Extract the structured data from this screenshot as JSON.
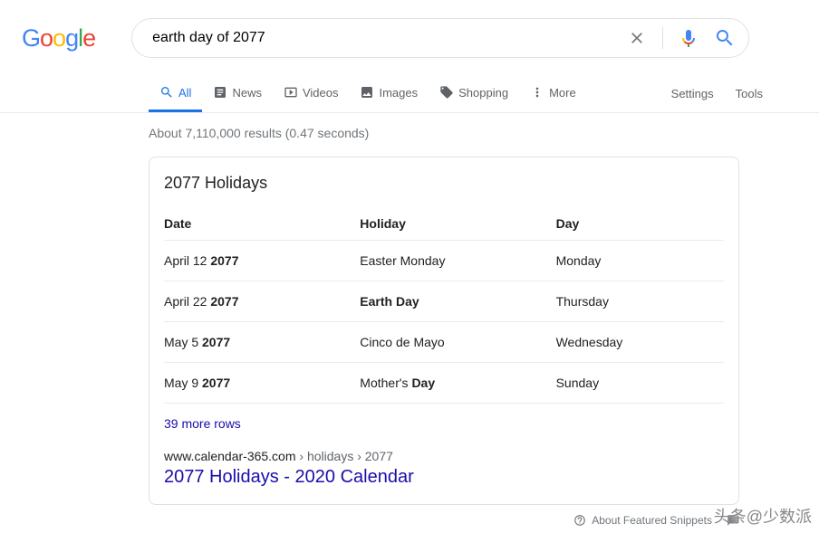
{
  "search": {
    "query": "earth day of 2077"
  },
  "tabs": {
    "all": "All",
    "news": "News",
    "videos": "Videos",
    "images": "Images",
    "shopping": "Shopping",
    "more": "More",
    "settings": "Settings",
    "tools": "Tools"
  },
  "stats": "About 7,110,000 results (0.47 seconds)",
  "card": {
    "title": "2077 Holidays",
    "headers": {
      "date": "Date",
      "holiday": "Holiday",
      "day": "Day"
    },
    "rows": [
      {
        "date_pre": "April 12 ",
        "date_bold": "2077",
        "holiday_pre": "Easter Monday",
        "holiday_bold": "",
        "day": "Monday"
      },
      {
        "date_pre": "April 22 ",
        "date_bold": "2077",
        "holiday_pre": "",
        "holiday_bold": "Earth Day",
        "day": "Thursday"
      },
      {
        "date_pre": "May 5 ",
        "date_bold": "2077",
        "holiday_pre": "Cinco de Mayo",
        "holiday_bold": "",
        "day": "Wednesday"
      },
      {
        "date_pre": "May 9 ",
        "date_bold": "2077",
        "holiday_pre": "Mother's ",
        "holiday_bold": "Day",
        "day": "Sunday"
      }
    ],
    "more_rows": "39 more rows",
    "breadcrumb_site": "www.calendar-365.com",
    "breadcrumb_path": " › holidays › 2077",
    "result_title": "2077 Holidays - 2020 Calendar"
  },
  "snippet_info": "About Featured Snippets",
  "watermark": "头条@少数派"
}
